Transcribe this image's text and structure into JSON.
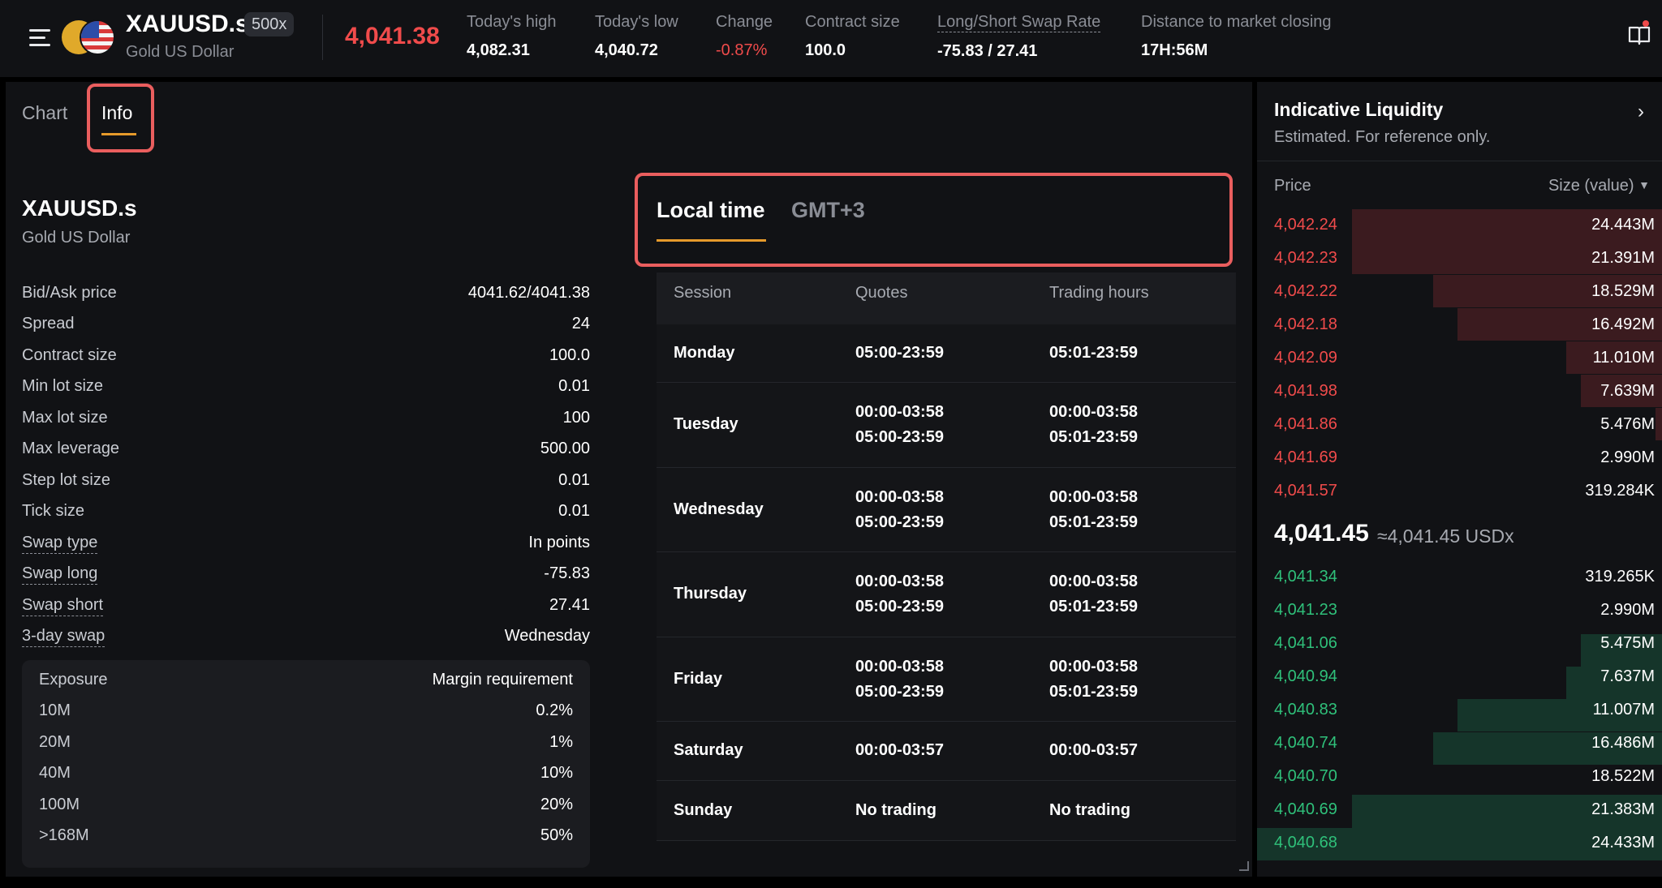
{
  "header": {
    "symbol": "XAUUSD.s",
    "leverage_badge": "500x",
    "name": "Gold US Dollar",
    "price": "4,041.38",
    "stats": {
      "high_label": "Today's high",
      "high_value": "4,082.31",
      "low_label": "Today's low",
      "low_value": "4,040.72",
      "change_label": "Change",
      "change_value": "-0.87%",
      "contract_label": "Contract size",
      "contract_value": "100.0",
      "swap_label": "Long/Short Swap Rate",
      "swap_value": "-75.83 / 27.41",
      "close_label": "Distance to market closing",
      "close_value": "17H:56M"
    }
  },
  "tabs": {
    "chart": "Chart",
    "info": "Info"
  },
  "info": {
    "title": "XAUUSD.s",
    "subtitle": "Gold US Dollar",
    "specs": [
      {
        "label": "Bid/Ask price",
        "value": "4041.62/4041.38"
      },
      {
        "label": "Spread",
        "value": "24"
      },
      {
        "label": "Contract size",
        "value": "100.0"
      },
      {
        "label": "Min lot size",
        "value": "0.01"
      },
      {
        "label": "Max lot size",
        "value": "100"
      },
      {
        "label": "Max leverage",
        "value": "500.00"
      },
      {
        "label": "Step lot size",
        "value": "0.01"
      },
      {
        "label": "Tick size",
        "value": "0.01"
      },
      {
        "label": "Swap type",
        "value": "In points"
      },
      {
        "label": "Swap long",
        "value": "-75.83"
      },
      {
        "label": "Swap short",
        "value": "27.41"
      },
      {
        "label": "3-day swap",
        "value": "Wednesday"
      }
    ],
    "margin": {
      "header_left": "Exposure",
      "header_right": "Margin requirement",
      "rows": [
        {
          "exposure": "10M",
          "margin": "0.2%"
        },
        {
          "exposure": "20M",
          "margin": "1%"
        },
        {
          "exposure": "40M",
          "margin": "10%"
        },
        {
          "exposure": "100M",
          "margin": "20%"
        },
        {
          "exposure": ">168M",
          "margin": "50%"
        }
      ]
    }
  },
  "schedule": {
    "tz_local": "Local time",
    "tz_gmt": "GMT+3",
    "columns": [
      "Session",
      "Quotes",
      "Trading hours"
    ],
    "rows": [
      {
        "day": "Monday",
        "quotes": "05:00-23:59",
        "hours": "05:01-23:59"
      },
      {
        "day": "Tuesday",
        "quotes": "00:00-03:58\n05:00-23:59",
        "hours": "00:00-03:58\n05:01-23:59"
      },
      {
        "day": "Wednesday",
        "quotes": "00:00-03:58\n05:00-23:59",
        "hours": "00:00-03:58\n05:01-23:59"
      },
      {
        "day": "Thursday",
        "quotes": "00:00-03:58\n05:00-23:59",
        "hours": "00:00-03:58\n05:01-23:59"
      },
      {
        "day": "Friday",
        "quotes": "00:00-03:58\n05:00-23:59",
        "hours": "00:00-03:58\n05:01-23:59"
      },
      {
        "day": "Saturday",
        "quotes": "00:00-03:57",
        "hours": "00:00-03:57"
      },
      {
        "day": "Sunday",
        "quotes": "No trading",
        "hours": "No trading"
      }
    ]
  },
  "liquidity": {
    "title": "Indicative Liquidity",
    "subtitle": "Estimated. For reference only.",
    "col_price": "Price",
    "col_size": "Size (value)",
    "asks": [
      {
        "price": "4,042.24",
        "size": "24.443M"
      },
      {
        "price": "4,042.23",
        "size": "21.391M"
      },
      {
        "price": "4,042.22",
        "size": "18.529M"
      },
      {
        "price": "4,042.18",
        "size": "16.492M"
      },
      {
        "price": "4,042.09",
        "size": "11.010M"
      },
      {
        "price": "4,041.98",
        "size": "7.639M"
      },
      {
        "price": "4,041.86",
        "size": "5.476M"
      },
      {
        "price": "4,041.69",
        "size": "2.990M"
      },
      {
        "price": "4,041.57",
        "size": "319.284K"
      }
    ],
    "mid_price": "4,041.45",
    "mid_approx": "≈4,041.45 USDx",
    "bids": [
      {
        "price": "4,041.34",
        "size": "319.265K"
      },
      {
        "price": "4,041.23",
        "size": "2.990M"
      },
      {
        "price": "4,041.06",
        "size": "5.475M"
      },
      {
        "price": "4,040.94",
        "size": "7.637M"
      },
      {
        "price": "4,040.83",
        "size": "11.007M"
      },
      {
        "price": "4,040.74",
        "size": "16.486M"
      },
      {
        "price": "4,040.70",
        "size": "18.522M"
      },
      {
        "price": "4,040.69",
        "size": "21.383M"
      },
      {
        "price": "4,040.68",
        "size": "24.433M"
      }
    ]
  },
  "colors": {
    "accent": "#e69a2b",
    "ask": "#f04b4b",
    "bid": "#2fc07a",
    "highlight": "#ea5e5e"
  }
}
